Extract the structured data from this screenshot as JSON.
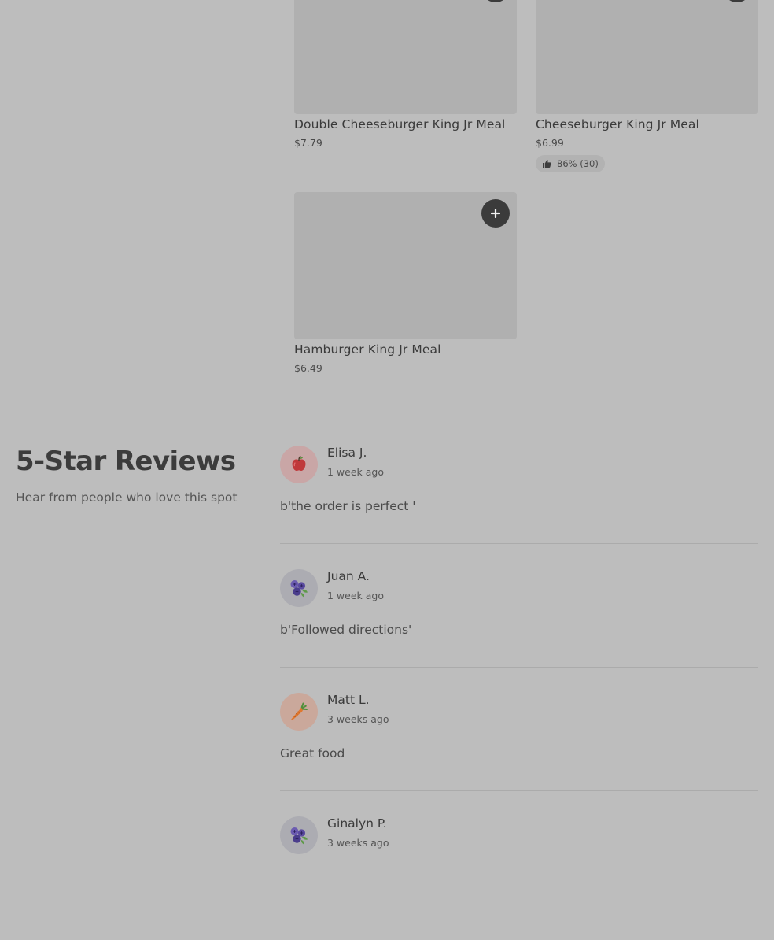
{
  "menu": {
    "items": [
      {
        "name": "Double Cheeseburger King Jr Meal",
        "price": "$7.79"
      },
      {
        "name": "Cheeseburger King Jr Meal",
        "price": "$6.99",
        "rating": "86% (30)"
      },
      {
        "name": "Hamburger King Jr Meal",
        "price": "$6.49"
      }
    ]
  },
  "reviews_section": {
    "title": "5-Star Reviews",
    "subtitle": "Hear from people who love this spot",
    "reviews": [
      {
        "name": "Elisa J.",
        "time": "1 week ago",
        "text": "b'the order is perfect '",
        "avatar_icon": "apple-icon",
        "avatar_bg": "#c9a6a6"
      },
      {
        "name": "Juan A.",
        "time": "1 week ago",
        "text": "b'Followed directions'",
        "avatar_icon": "blueberries-icon",
        "avatar_bg": "#acacb2"
      },
      {
        "name": "Matt L.",
        "time": "3 weeks ago",
        "text": "Great food",
        "avatar_icon": "carrot-icon",
        "avatar_bg": "#caa89b"
      },
      {
        "name": "Ginalyn P.",
        "time": "3 weeks ago",
        "text": "",
        "avatar_icon": "blueberries-icon",
        "avatar_bg": "#acacb2"
      }
    ]
  },
  "colors": {
    "overlay_bg": "#bdbdbd",
    "add_button": "#3b3b3b",
    "image_placeholder": "#b0b0b0"
  }
}
